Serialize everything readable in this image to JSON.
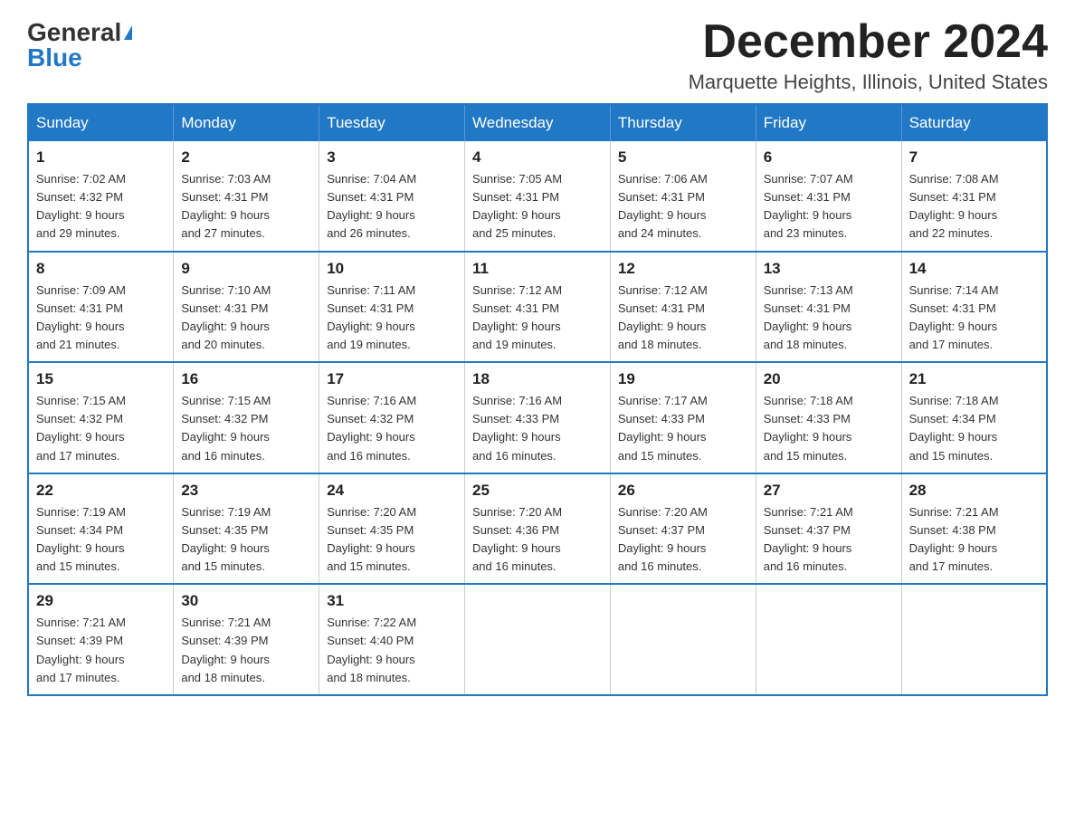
{
  "header": {
    "logo_general": "General",
    "logo_blue": "Blue",
    "month_title": "December 2024",
    "location": "Marquette Heights, Illinois, United States"
  },
  "days_of_week": [
    "Sunday",
    "Monday",
    "Tuesday",
    "Wednesday",
    "Thursday",
    "Friday",
    "Saturday"
  ],
  "weeks": [
    [
      {
        "day": "1",
        "sunrise": "7:02 AM",
        "sunset": "4:32 PM",
        "daylight": "9 hours and 29 minutes."
      },
      {
        "day": "2",
        "sunrise": "7:03 AM",
        "sunset": "4:31 PM",
        "daylight": "9 hours and 27 minutes."
      },
      {
        "day": "3",
        "sunrise": "7:04 AM",
        "sunset": "4:31 PM",
        "daylight": "9 hours and 26 minutes."
      },
      {
        "day": "4",
        "sunrise": "7:05 AM",
        "sunset": "4:31 PM",
        "daylight": "9 hours and 25 minutes."
      },
      {
        "day": "5",
        "sunrise": "7:06 AM",
        "sunset": "4:31 PM",
        "daylight": "9 hours and 24 minutes."
      },
      {
        "day": "6",
        "sunrise": "7:07 AM",
        "sunset": "4:31 PM",
        "daylight": "9 hours and 23 minutes."
      },
      {
        "day": "7",
        "sunrise": "7:08 AM",
        "sunset": "4:31 PM",
        "daylight": "9 hours and 22 minutes."
      }
    ],
    [
      {
        "day": "8",
        "sunrise": "7:09 AM",
        "sunset": "4:31 PM",
        "daylight": "9 hours and 21 minutes."
      },
      {
        "day": "9",
        "sunrise": "7:10 AM",
        "sunset": "4:31 PM",
        "daylight": "9 hours and 20 minutes."
      },
      {
        "day": "10",
        "sunrise": "7:11 AM",
        "sunset": "4:31 PM",
        "daylight": "9 hours and 19 minutes."
      },
      {
        "day": "11",
        "sunrise": "7:12 AM",
        "sunset": "4:31 PM",
        "daylight": "9 hours and 19 minutes."
      },
      {
        "day": "12",
        "sunrise": "7:12 AM",
        "sunset": "4:31 PM",
        "daylight": "9 hours and 18 minutes."
      },
      {
        "day": "13",
        "sunrise": "7:13 AM",
        "sunset": "4:31 PM",
        "daylight": "9 hours and 18 minutes."
      },
      {
        "day": "14",
        "sunrise": "7:14 AM",
        "sunset": "4:31 PM",
        "daylight": "9 hours and 17 minutes."
      }
    ],
    [
      {
        "day": "15",
        "sunrise": "7:15 AM",
        "sunset": "4:32 PM",
        "daylight": "9 hours and 17 minutes."
      },
      {
        "day": "16",
        "sunrise": "7:15 AM",
        "sunset": "4:32 PM",
        "daylight": "9 hours and 16 minutes."
      },
      {
        "day": "17",
        "sunrise": "7:16 AM",
        "sunset": "4:32 PM",
        "daylight": "9 hours and 16 minutes."
      },
      {
        "day": "18",
        "sunrise": "7:16 AM",
        "sunset": "4:33 PM",
        "daylight": "9 hours and 16 minutes."
      },
      {
        "day": "19",
        "sunrise": "7:17 AM",
        "sunset": "4:33 PM",
        "daylight": "9 hours and 15 minutes."
      },
      {
        "day": "20",
        "sunrise": "7:18 AM",
        "sunset": "4:33 PM",
        "daylight": "9 hours and 15 minutes."
      },
      {
        "day": "21",
        "sunrise": "7:18 AM",
        "sunset": "4:34 PM",
        "daylight": "9 hours and 15 minutes."
      }
    ],
    [
      {
        "day": "22",
        "sunrise": "7:19 AM",
        "sunset": "4:34 PM",
        "daylight": "9 hours and 15 minutes."
      },
      {
        "day": "23",
        "sunrise": "7:19 AM",
        "sunset": "4:35 PM",
        "daylight": "9 hours and 15 minutes."
      },
      {
        "day": "24",
        "sunrise": "7:20 AM",
        "sunset": "4:35 PM",
        "daylight": "9 hours and 15 minutes."
      },
      {
        "day": "25",
        "sunrise": "7:20 AM",
        "sunset": "4:36 PM",
        "daylight": "9 hours and 16 minutes."
      },
      {
        "day": "26",
        "sunrise": "7:20 AM",
        "sunset": "4:37 PM",
        "daylight": "9 hours and 16 minutes."
      },
      {
        "day": "27",
        "sunrise": "7:21 AM",
        "sunset": "4:37 PM",
        "daylight": "9 hours and 16 minutes."
      },
      {
        "day": "28",
        "sunrise": "7:21 AM",
        "sunset": "4:38 PM",
        "daylight": "9 hours and 17 minutes."
      }
    ],
    [
      {
        "day": "29",
        "sunrise": "7:21 AM",
        "sunset": "4:39 PM",
        "daylight": "9 hours and 17 minutes."
      },
      {
        "day": "30",
        "sunrise": "7:21 AM",
        "sunset": "4:39 PM",
        "daylight": "9 hours and 18 minutes."
      },
      {
        "day": "31",
        "sunrise": "7:22 AM",
        "sunset": "4:40 PM",
        "daylight": "9 hours and 18 minutes."
      },
      null,
      null,
      null,
      null
    ]
  ],
  "labels": {
    "sunrise_prefix": "Sunrise: ",
    "sunset_prefix": "Sunset: ",
    "daylight_prefix": "Daylight: "
  }
}
